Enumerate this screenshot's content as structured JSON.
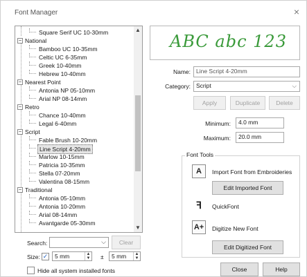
{
  "window": {
    "title": "Font Manager",
    "close_glyph": "×"
  },
  "tree": {
    "groups": [
      {
        "label": "National",
        "expander": "−"
      },
      {
        "label": "Nearest Point",
        "expander": "−"
      },
      {
        "label": "Retro",
        "expander": "−"
      },
      {
        "label": "Script",
        "expander": "−"
      },
      {
        "label": "Traditional",
        "expander": "−"
      }
    ],
    "leaves": [
      "Square Serif UC 10-30mm",
      "Bamboo UC 10-35mm",
      "Celtic UC 6-35mm",
      "Greek 10-40mm",
      "Hebrew 10-40mm",
      "Antonia NP 05-10mm",
      "Arial NP 08-14mm",
      "Chance 10-40mm",
      "Legal 6-40mm",
      "Fable Brush 10-20mm",
      "Line Script 4-20mm",
      "Marlow 10-15mm",
      "Patricia 10-35mm",
      "Stella 07-20mm",
      "Valentina 08-15mm",
      "Antonia 05-10mm",
      "Antonia 10-20mm",
      "Arial 08-14mm",
      "Avantgarde 05-30mm"
    ],
    "selected": "Line Script 4-20mm",
    "scroll_up": "▲",
    "scroll_down": "▼"
  },
  "search": {
    "label": "Search:",
    "value": "",
    "arrow": "⌵",
    "clear_label": "Clear"
  },
  "size": {
    "label": "Size:",
    "checked": "✓",
    "min_value": "5 mm",
    "pm": "±",
    "max_value": "5 mm"
  },
  "hide_system": {
    "label": "Hide all system installed fonts",
    "checked": ""
  },
  "preview": {
    "text": "ABC abc 123",
    "color": "#3a9a3a"
  },
  "details": {
    "name_label": "Name:",
    "name_value": "Line Script 4-20mm",
    "category_label": "Category:",
    "category_value": "Script",
    "category_arrow": "⌵",
    "apply_label": "Apply",
    "duplicate_label": "Duplicate",
    "delete_label": "Delete",
    "minimum_label": "Minimum:",
    "minimum_value": "4.0 mm",
    "maximum_label": "Maximum:",
    "maximum_value": "20.0 mm"
  },
  "font_tools": {
    "title": "Font Tools",
    "import_label": "Import Font from Embroideries",
    "edit_imported_label": "Edit Imported Font",
    "quickfont_label": "QuickFont",
    "digitize_label": "Digitize New Font",
    "edit_digitized_label": "Edit Digitized Font"
  },
  "footer": {
    "close_label": "Close",
    "help_label": "Help"
  }
}
